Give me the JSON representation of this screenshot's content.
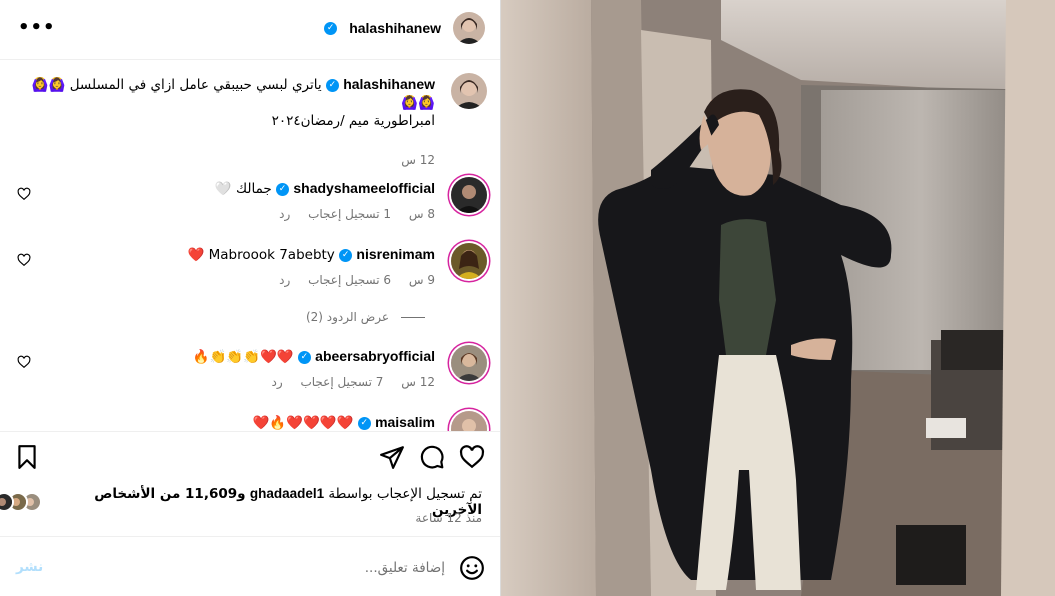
{
  "post": {
    "author": "halashihanew",
    "caption_line1": "ياتري لبسي حبيبقي عامل ازاي في المسلسل 🙆‍♀️🙆‍♀️",
    "caption_emoji2": "🙆‍♀️🙆‍♀️",
    "caption_line2": "امبراطورية ميم /رمضان٢٠٢٤",
    "caption_time": "12 س"
  },
  "comments": [
    {
      "username": "shadyshameelofficial",
      "text": "جمالك 🤍",
      "time": "8 س",
      "likes": "1 تسجيل إعجاب",
      "reply": "رد"
    },
    {
      "username": "nisrenimam",
      "text": "Mabroook 7abebty ❤️",
      "time": "9 س",
      "likes": "6 تسجيل إعجاب",
      "reply": "رد"
    },
    {
      "username": "abeersabryofficial",
      "text": "❤️❤️👏👏👏🔥",
      "time": "12 س",
      "likes": "7 تسجيل إعجاب",
      "reply": "رد"
    },
    {
      "username": "maisalim",
      "text": "❤️❤️❤️❤️🔥❤️",
      "time": "",
      "likes": "",
      "reply": ""
    }
  ],
  "view_replies": "عرض الردود (2)",
  "likes_summary": {
    "prefix": "تم تسجيل الإعجاب بواسطة",
    "liker": "ghadaadel1",
    "suffix": "و11,609 من الأشخاص الآخرين"
  },
  "timestamp": "منذ 12 ساعة",
  "add_comment": {
    "placeholder": "إضافة تعليق...",
    "post_label": "نشر"
  },
  "more_label": "•••",
  "icons": {
    "more": "more-horizontal-icon",
    "verified": "verified-badge-icon",
    "like": "heart-icon",
    "comment": "comment-icon",
    "share": "paper-plane-icon",
    "save": "bookmark-icon",
    "emoji": "smiley-icon"
  },
  "colors": {
    "verified": "#0095f6",
    "secondary_text": "#737373",
    "post_button_disabled": "#b2dffc"
  }
}
